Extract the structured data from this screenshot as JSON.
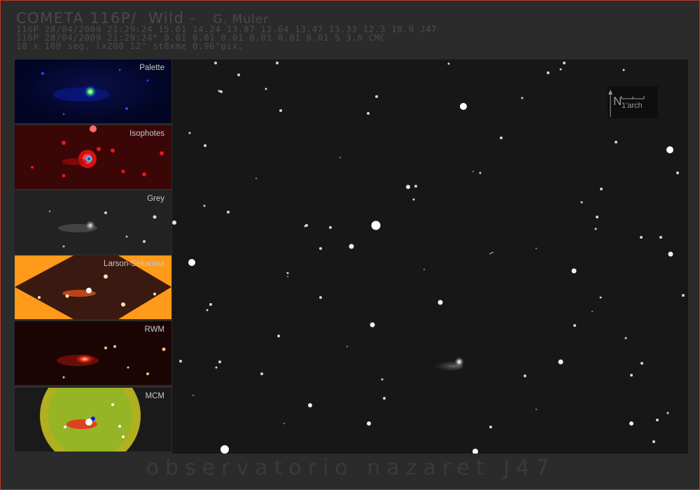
{
  "header": {
    "title": "COMETA 116P/  Wild -",
    "author": "G. Muler",
    "line1": "116P 28/04/2009 21:29:24 15.01 14.24 13.87 13.64 13.47 13.33 12.3 18.9 J47",
    "line2": "116P 28/04/2009 21:29:24* 0.01 0.01 0.01 0.01 0.01 0.01 5 3.6 CMC",
    "line3": "10 x 100 seg. lx200 12\" st8xme 0.96\"pix."
  },
  "panels": [
    {
      "label": "Palette"
    },
    {
      "label": "Isophotes"
    },
    {
      "label": "Grey"
    },
    {
      "label": "Larson-Sekanina"
    },
    {
      "label": "RWM"
    },
    {
      "label": "MCM"
    }
  ],
  "scale_bar": {
    "north": "N",
    "label": "1'arch"
  },
  "footer": "observatorio nazaret J47",
  "colors": {
    "frame_border": "#c0392b",
    "background": "#2b2b2b",
    "sky": "#171717"
  }
}
